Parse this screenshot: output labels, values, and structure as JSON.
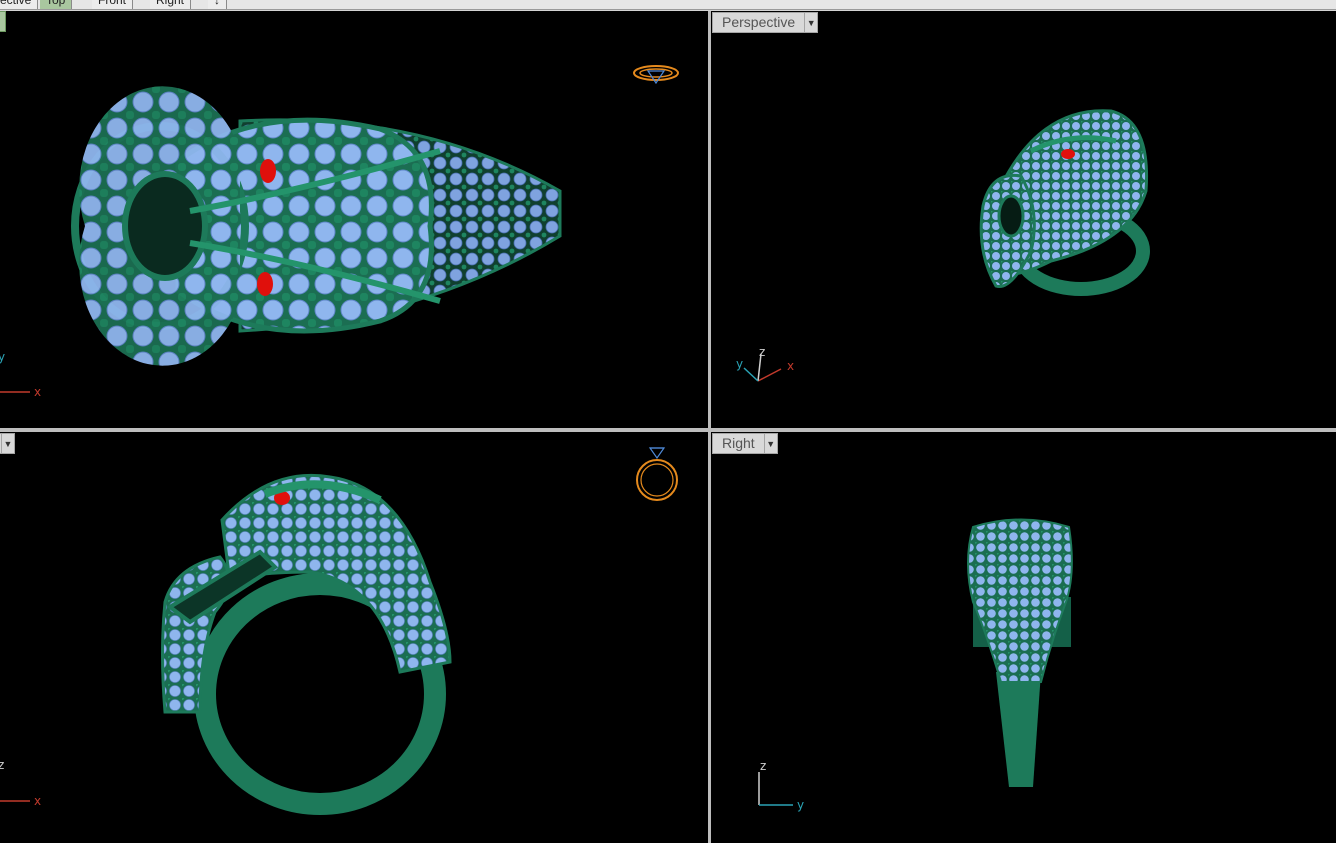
{
  "tabs": [
    {
      "label": "ective"
    },
    {
      "label": "Top"
    },
    {
      "label": "Front"
    },
    {
      "label": "Right"
    },
    {
      "label": "↓"
    }
  ],
  "viewports": {
    "top": {
      "label": "",
      "axes": {
        "h": "x",
        "v": "y"
      }
    },
    "perspective": {
      "label": "Perspective",
      "axes": {
        "a": "y",
        "b": "z",
        "c": "x"
      }
    },
    "front": {
      "label": "",
      "axes": {
        "h": "x",
        "v": "z"
      }
    },
    "right": {
      "label": "Right",
      "axes": {
        "h": "y",
        "v": "z"
      }
    }
  },
  "icons": {
    "dropdown": "triangle-down-icon",
    "ring_thumbnail": "ring-icon"
  },
  "colors": {
    "viewport_bg": "#000000",
    "model_green": "#1d7a5a",
    "gem_blue": "#8fb6ee",
    "eye_red": "#e0100c",
    "axis_x": "#c23a2c",
    "axis_y": "#2aa3b5",
    "axis_z": "#d0d0d0",
    "thumb_orange": "#e58a1d"
  }
}
